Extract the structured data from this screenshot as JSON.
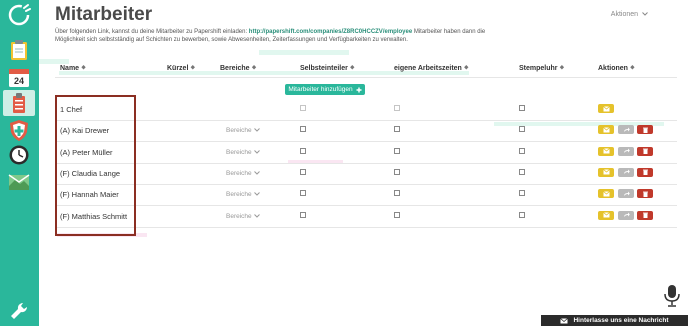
{
  "page": {
    "title": "Mitarbeiter",
    "actions_menu": "Aktionen",
    "description_prefix": "Über folgenden Link, kannst du deine Mitarbeiter zu Papershift einladen: ",
    "description_link": "http://papershift.com/companies/Z8RC0HCCZV/employee",
    "description_suffix": " Mitarbeiter haben dann die Möglichkeit sich selbstständig auf Schichten zu bewerben, sowie Abwesenheiten, Zeiterfassungen und Verfügbarkeiten zu verwalten."
  },
  "table": {
    "headers": {
      "name": "Name",
      "kuerzel": "Kürzel",
      "bereiche": "Bereiche",
      "selbsteinteiler": "Selbsteinteiler",
      "arbeitszeiten": "eigene Arbeitszeiten",
      "stempeluhr": "Stempeluhr",
      "aktionen": "Aktionen"
    },
    "add_button": "Mitarbeiter hinzufügen",
    "bereiche_label": "Bereiche",
    "rows": [
      {
        "name": "1 Chef",
        "show_bereiche": false
      },
      {
        "name": "(A) Kai Drewer",
        "show_bereiche": true
      },
      {
        "name": "(A) Peter Müller",
        "show_bereiche": true
      },
      {
        "name": "(F) Claudia Lange",
        "show_bereiche": true
      },
      {
        "name": "(F) Hannah Maier",
        "show_bereiche": true
      },
      {
        "name": "(F) Matthias Schmitt",
        "show_bereiche": true
      }
    ]
  },
  "chat": {
    "label": "Hinterlasse uns eine Nachricht"
  },
  "colors": {
    "accent": "#2ab79b",
    "edit": "#e5c22b",
    "transfer": "#b9b9b9",
    "delete": "#c0392b",
    "highlight_box": "#8b2e22"
  }
}
